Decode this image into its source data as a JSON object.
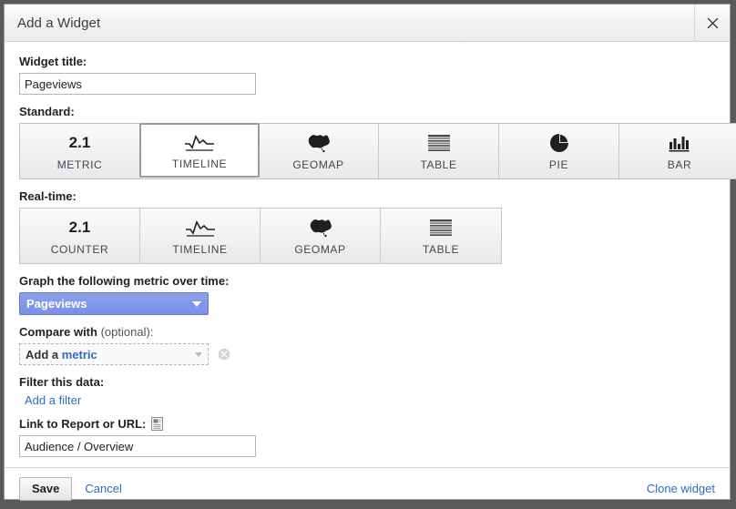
{
  "dialog": {
    "title": "Add a Widget",
    "close_icon": "close-icon"
  },
  "widget_title": {
    "label": "Widget title:",
    "value": "Pageviews",
    "placeholder": ""
  },
  "standard": {
    "label": "Standard:",
    "tiles": [
      {
        "label": "METRIC",
        "icon": "number-2-1-icon",
        "glyph": "2.1",
        "selected": false
      },
      {
        "label": "TIMELINE",
        "icon": "sparkline-icon",
        "glyph": "",
        "selected": true
      },
      {
        "label": "GEOMAP",
        "icon": "australia-map-icon",
        "glyph": "",
        "selected": false
      },
      {
        "label": "TABLE",
        "icon": "table-rows-icon",
        "glyph": "",
        "selected": false
      },
      {
        "label": "PIE",
        "icon": "pie-chart-icon",
        "glyph": "",
        "selected": false
      },
      {
        "label": "BAR",
        "icon": "bar-chart-icon",
        "glyph": "",
        "selected": false
      }
    ]
  },
  "realtime": {
    "label": "Real-time:",
    "tiles": [
      {
        "label": "COUNTER",
        "icon": "number-2-1-icon",
        "glyph": "2.1",
        "selected": false
      },
      {
        "label": "TIMELINE",
        "icon": "sparkline-icon",
        "glyph": "",
        "selected": false
      },
      {
        "label": "GEOMAP",
        "icon": "australia-map-icon",
        "glyph": "",
        "selected": false
      },
      {
        "label": "TABLE",
        "icon": "table-rows-icon",
        "glyph": "",
        "selected": false
      }
    ]
  },
  "metric": {
    "label": "Graph the following metric over time:",
    "selected": "Pageviews",
    "caret_icon": "chevron-down-icon"
  },
  "compare": {
    "label_bold": "Compare with",
    "label_optional": "(optional):",
    "prefix": "Add a",
    "link": "metric",
    "caret_icon": "chevron-down-icon",
    "remove_icon": "remove-circle-icon"
  },
  "filter": {
    "label": "Filter this data:",
    "add_link": "Add a filter"
  },
  "link_section": {
    "label": "Link to Report or URL:",
    "help_icon": "report-document-icon",
    "value": "Audience / Overview",
    "placeholder": ""
  },
  "footer": {
    "save_label": "Save",
    "cancel_label": "Cancel",
    "clone_label": "Clone widget"
  },
  "colors": {
    "accent_blue": "#7b90e6",
    "link_blue": "#2f6cc0",
    "dialog_bg": "#ffffff",
    "titlebar_bg": "#f2f2f2",
    "backdrop": "#5a5a5a"
  }
}
